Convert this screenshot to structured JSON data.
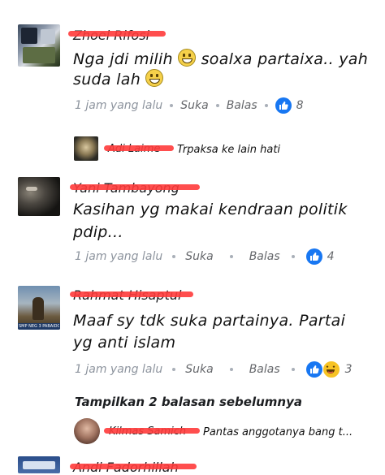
{
  "comments": [
    {
      "name": "Zhoel Rifosi",
      "line1": "Nga jdi milih",
      "line1b": "soalxa partaixa.. yah",
      "line2": "suda lah",
      "time": "1 jam yang lalu",
      "like_label": "Suka",
      "reply_label": "Balas",
      "reactions": "8"
    },
    {
      "name": "Adi Laime",
      "text": "Trpaksa ke lain hati"
    },
    {
      "name": "Yani Tambayong",
      "line1": "Kasihan yg makai kendraan politik",
      "line2": "pdip...",
      "time": "1 jam yang lalu",
      "like_label": "Suka",
      "reply_label": "Balas",
      "reactions": "4"
    },
    {
      "name": "Rahmat Hisaptul",
      "line1": "Maaf sy tdk suka partainya. Partai",
      "line2": "yg anti islam",
      "time": "1 jam yang lalu",
      "like_label": "Suka",
      "reply_label": "Balas",
      "reactions": "3"
    },
    {
      "name": "Kilmas Samich",
      "text": "Pantas anggotanya bang t..."
    }
  ],
  "show_previous": "Tampilkan 2 balasan sebelumnya",
  "bottom_name": "Andi Fadorhillah",
  "avatar_caption": "SMP NEG 3 PABAIDO",
  "colors": {
    "like": "#1877f2",
    "redact": "#ff3b3b",
    "meta": "#8d949e"
  }
}
